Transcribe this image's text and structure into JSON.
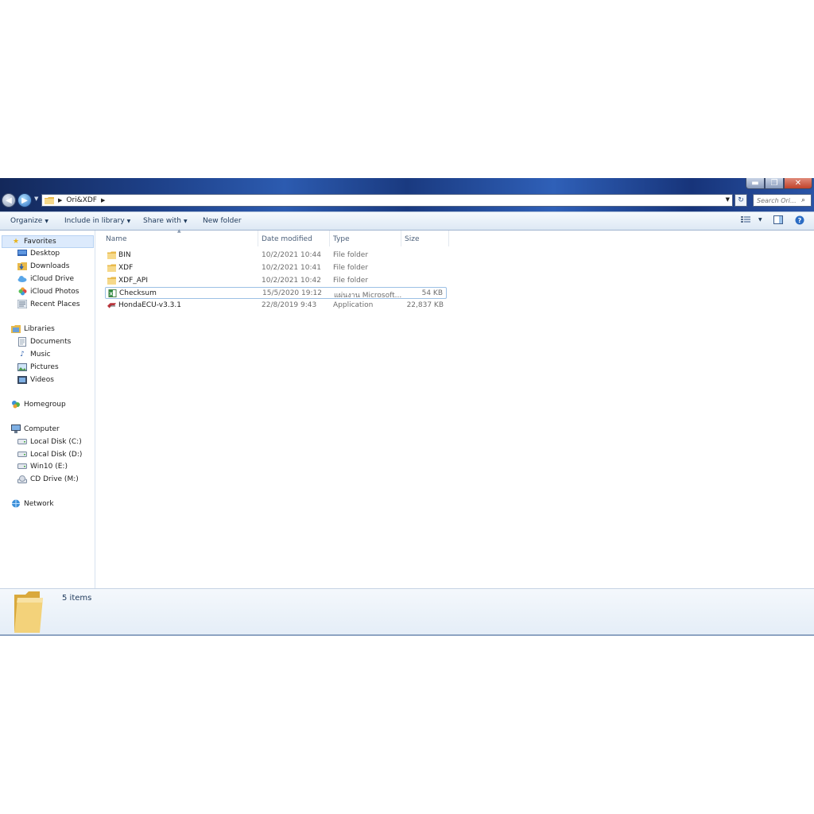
{
  "window": {
    "caption_buttons": {
      "minimize": "▬",
      "maximize": "❐",
      "close": "✕"
    }
  },
  "address_bar": {
    "crumbs": [
      "Ori&XDF"
    ],
    "search_placeholder": "Search Ori..."
  },
  "toolbar": {
    "organize": "Organize",
    "include_in_library": "Include in library",
    "share_with": "Share with",
    "new_folder": "New folder"
  },
  "sidebar": {
    "favorites": {
      "label": "Favorites",
      "items": [
        "Desktop",
        "Downloads",
        "iCloud Drive",
        "iCloud Photos",
        "Recent Places"
      ]
    },
    "libraries": {
      "label": "Libraries",
      "items": [
        "Documents",
        "Music",
        "Pictures",
        "Videos"
      ]
    },
    "homegroup": "Homegroup",
    "computer": {
      "label": "Computer",
      "items": [
        "Local Disk (C:)",
        "Local Disk (D:)",
        "Win10 (E:)",
        "CD Drive (M:)"
      ]
    },
    "network": "Network"
  },
  "columns": {
    "name": "Name",
    "date": "Date modified",
    "type": "Type",
    "size": "Size"
  },
  "files": [
    {
      "name": "BIN",
      "date": "10/2/2021 10:44",
      "type": "File folder",
      "size": "",
      "icon": "folder-icon"
    },
    {
      "name": "XDF",
      "date": "10/2/2021 10:41",
      "type": "File folder",
      "size": "",
      "icon": "folder-icon"
    },
    {
      "name": "XDF_API",
      "date": "10/2/2021 10:42",
      "type": "File folder",
      "size": "",
      "icon": "folder-icon"
    },
    {
      "name": "Checksum",
      "date": "15/5/2020 19:12",
      "type": "แผ่นงาน Microsoft...",
      "size": "54 KB",
      "icon": "excel-sheet-icon"
    },
    {
      "name": "HondaECU-v3.3.1",
      "date": "22/8/2019 9:43",
      "type": "Application",
      "size": "22,837 KB",
      "icon": "application-icon"
    }
  ],
  "status": {
    "item_count": "5 items"
  },
  "colors": {
    "title_bar": "#1d3f86",
    "toolbar_text": "#1e395b",
    "folder_yellow": "#f3d27a"
  }
}
